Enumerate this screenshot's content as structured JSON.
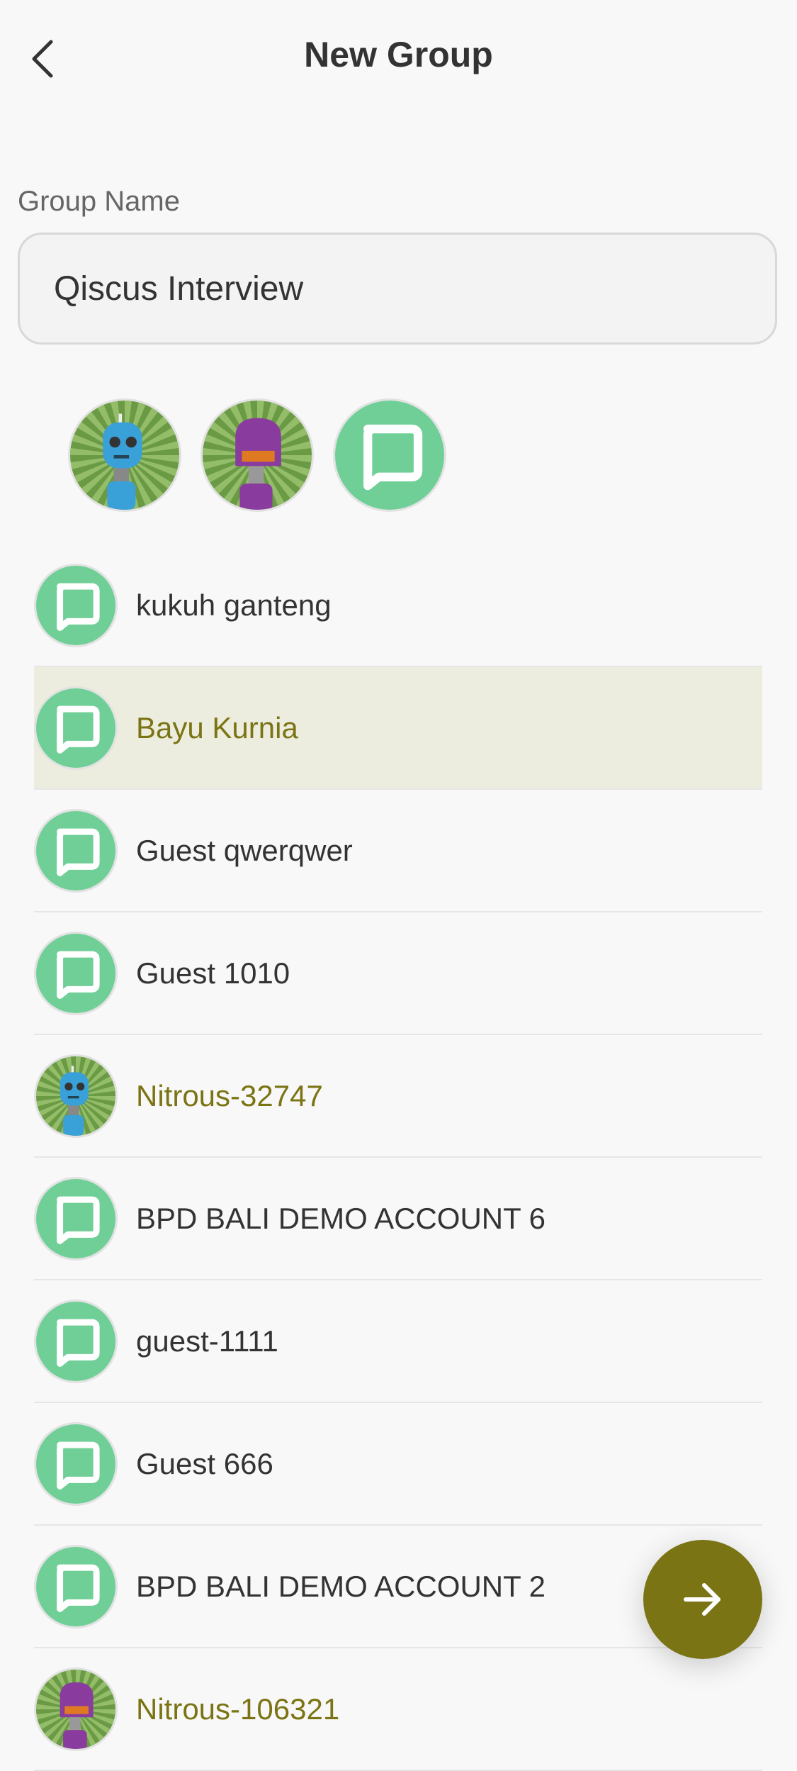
{
  "header": {
    "title": "New Group"
  },
  "group_name": {
    "label": "Group Name",
    "value": "Qiscus Interview"
  },
  "selected_members": [
    {
      "avatar": "blue-robot-avatar"
    },
    {
      "avatar": "purple-robot-avatar"
    },
    {
      "avatar": "qiscus-logo-avatar"
    }
  ],
  "contacts": [
    {
      "name": "kukuh ganteng",
      "avatar": "qiscus-logo-avatar",
      "selected": false
    },
    {
      "name": "Bayu Kurnia",
      "avatar": "qiscus-logo-avatar",
      "selected": true
    },
    {
      "name": "Guest qwerqwer",
      "avatar": "qiscus-logo-avatar",
      "selected": false
    },
    {
      "name": "Guest 1010",
      "avatar": "qiscus-logo-avatar",
      "selected": false
    },
    {
      "name": "Nitrous-32747",
      "avatar": "blue-robot-avatar",
      "selected": true
    },
    {
      "name": "BPD BALI DEMO ACCOUNT 6",
      "avatar": "qiscus-logo-avatar",
      "selected": false
    },
    {
      "name": "guest-1111",
      "avatar": "qiscus-logo-avatar",
      "selected": false
    },
    {
      "name": "Guest 666",
      "avatar": "qiscus-logo-avatar",
      "selected": false
    },
    {
      "name": "BPD BALI DEMO ACCOUNT 2",
      "avatar": "qiscus-logo-avatar",
      "selected": false
    },
    {
      "name": "Nitrous-106321",
      "avatar": "purple-robot-avatar",
      "selected": true
    }
  ],
  "colors": {
    "accent": "#7b7414",
    "highlight_bg": "#ededdf",
    "logo_green": "#6fcf97"
  },
  "fab": {
    "icon": "arrow-right-icon"
  }
}
